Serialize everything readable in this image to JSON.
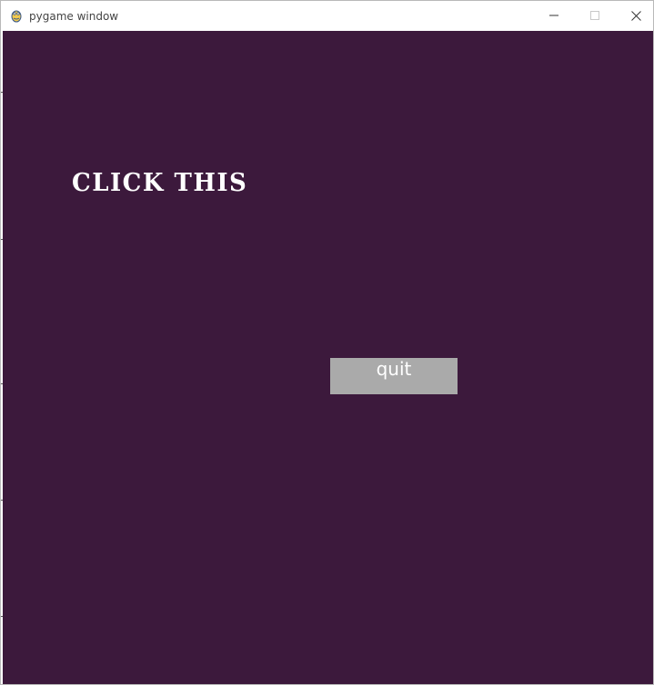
{
  "window": {
    "title": "pygame window",
    "app_icon": "pygame-snake-icon",
    "controls": {
      "minimize_icon": "minimize-icon",
      "maximize_icon": "maximize-icon",
      "close_icon": "close-icon"
    }
  },
  "game": {
    "background_color": "#3c193c",
    "heading": "CLICK THIS",
    "heading_color": "#ffffff",
    "quit_button": {
      "label": "quit",
      "background_color": "#aaaaaa",
      "text_color": "#ffffff"
    }
  }
}
